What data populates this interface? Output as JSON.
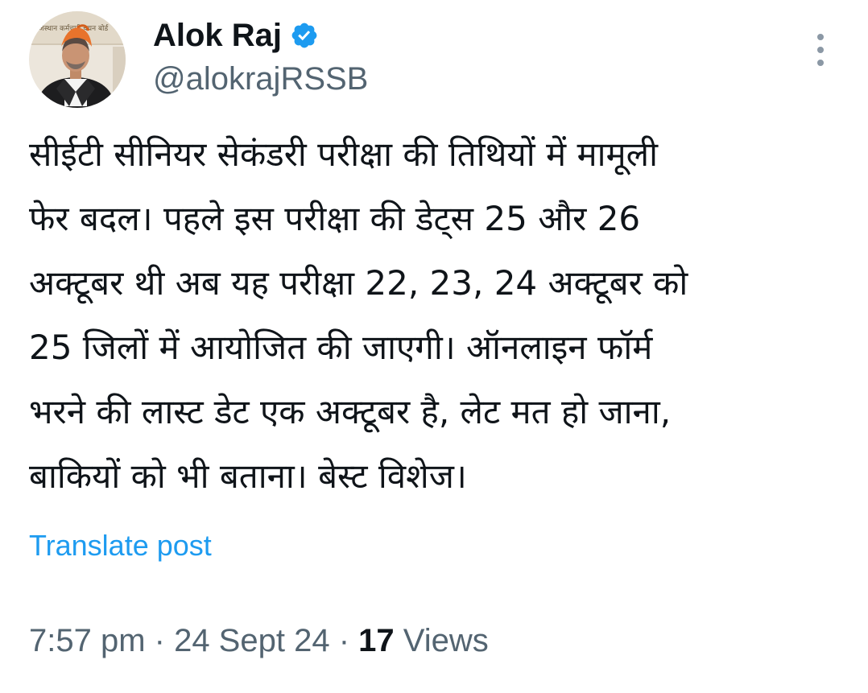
{
  "author": {
    "display_name": "Alok Raj",
    "handle": "@alokrajRSSB",
    "verified": true,
    "verified_color": "#1d9bf0",
    "avatar_icon": "profile-photo",
    "avatar_banner_text": "राजस्थान कर्मचारी चयन बोर्ड"
  },
  "menu": {
    "icon": "more-vertical-icon"
  },
  "post": {
    "lines": [
      "सीईटी सीनियर सेकंडरी परीक्षा की तिथियों में मामूली",
      "फेर बदल। पहले इस परीक्षा की डेट्स 25 और 26",
      "अक्टूबर थी अब यह परीक्षा 22, 23, 24 अक्टूबर को",
      "25 जिलों में आयोजित की जाएगी। ऑनलाइन फॉर्म",
      "भरने की लास्ट डेट एक अक्टूबर है, लेट मत हो जाना,",
      "बाकियों को भी बताना। बेस्ट विशेज।"
    ]
  },
  "translate_label": "Translate post",
  "meta": {
    "time": "7:57 pm",
    "separator": " · ",
    "date": "24 Sept 24",
    "views_count": "17",
    "views_label": " Views"
  },
  "colors": {
    "text": "#0f1419",
    "secondary": "#536471",
    "link": "#1d9bf0",
    "background": "#ffffff"
  }
}
